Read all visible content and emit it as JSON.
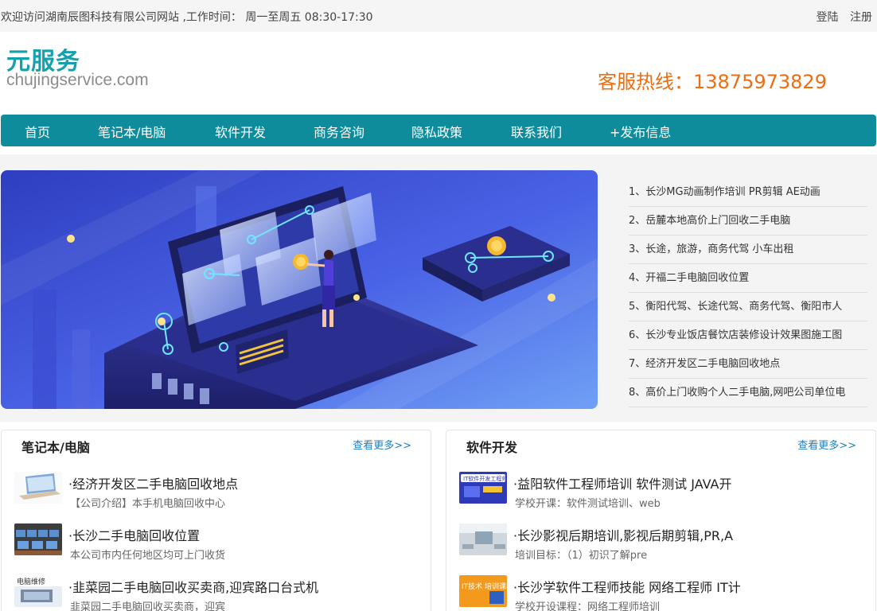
{
  "topbar": {
    "welcome": "欢迎访问湖南辰图科技有限公司网站 ,工作时间： 周一至周五 08:30-17:30",
    "login": "登陆",
    "register": "注册"
  },
  "header": {
    "logo_title": "元服务",
    "logo_domain": "chujingservice.com",
    "hotline": "客服热线：13875973829"
  },
  "nav": {
    "items": [
      {
        "label": "首页"
      },
      {
        "label": "笔记本/电脑"
      },
      {
        "label": "软件开发"
      },
      {
        "label": "商务咨询"
      },
      {
        "label": "隐私政策"
      },
      {
        "label": "联系我们"
      },
      {
        "label": "+发布信息"
      }
    ]
  },
  "hotlist": {
    "items": [
      "1、长沙MG动画制作培训 PR剪辑 AE动画",
      "2、岳麓本地高价上门回收二手电脑",
      "3、长途，旅游，商务代驾 小车出租",
      "4、开福二手电脑回收位置",
      "5、衡阳代驾、长途代驾、商务代驾、衡阳市人",
      "6、长沙专业饭店餐饮店装修设计效果图施工图",
      "7、经济开发区二手电脑回收地点",
      "8、高价上门收购个人二手电脑,网吧公司单位电"
    ]
  },
  "panels": {
    "left": {
      "title": "笔记本/电脑",
      "more": "查看更多>>",
      "entries": [
        {
          "title": "·经济开发区二手电脑回收地点",
          "desc": "【公司介绍】本手机电脑回收中心"
        },
        {
          "title": "·长沙二手电脑回收位置",
          "desc": "本公司市内任何地区均可上门收货"
        },
        {
          "title": "·韭菜园二手电脑回收买卖商,迎宾路口台式机",
          "desc": "韭菜园二手电脑回收买卖商，迎宾"
        }
      ]
    },
    "right": {
      "title": "软件开发",
      "more": "查看更多>>",
      "entries": [
        {
          "title": "·益阳软件工程师培训 软件测试 JAVA开",
          "desc": "学校开课：软件测试培训、web"
        },
        {
          "title": "·长沙影视后期培训,影视后期剪辑,PR,A",
          "desc": "培训目标：（1）初识了解pre"
        },
        {
          "title": "·长沙学软件工程师技能 网络工程师 IT计",
          "desc": "学校开设课程：网络工程师培训"
        }
      ]
    }
  },
  "thumbs": {
    "right_1_caption": "IT软件开发工程师",
    "right_3_caption": "IT技术 培训课程",
    "left_3_caption": "电脑维修"
  },
  "colors": {
    "brand_teal": "#0f8c9c",
    "hotline_orange": "#ee6d13",
    "link_blue": "#1e7fc2"
  }
}
